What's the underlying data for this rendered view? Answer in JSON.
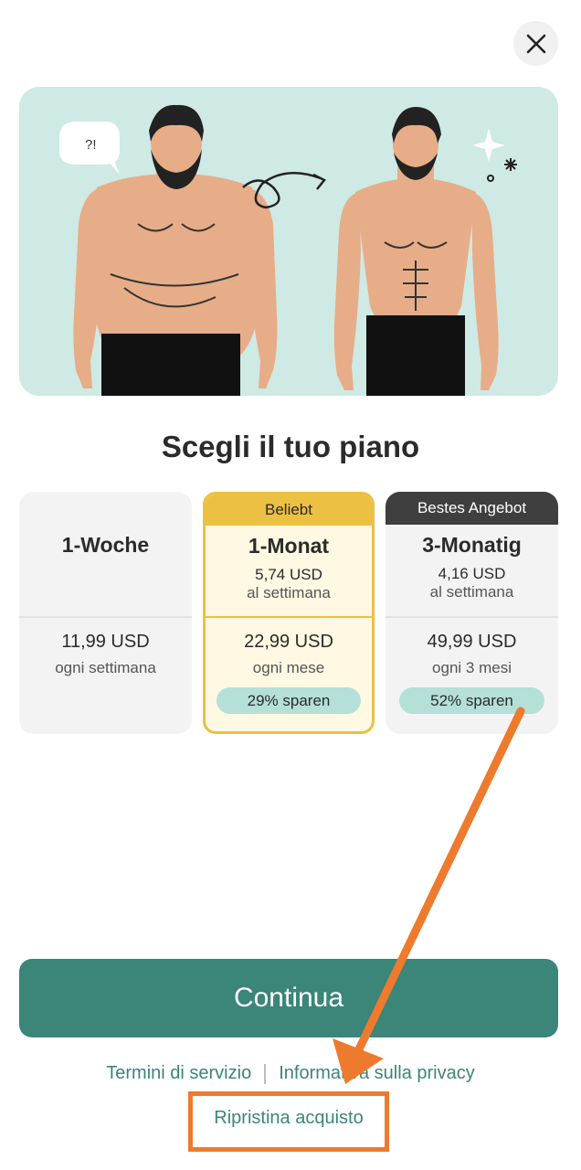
{
  "header": {
    "close_icon": "close-icon"
  },
  "hero": {
    "speech_bubble": "?!"
  },
  "title": "Scegli il tuo piano",
  "plans": [
    {
      "name": "1-Woche",
      "price": "11,99 USD",
      "period": "ogni settimana"
    },
    {
      "badge": "Beliebt",
      "name": "1-Monat",
      "weekly_price": "5,74 USD",
      "weekly_label": "al settimana",
      "price": "22,99 USD",
      "period": "ogni mese",
      "savings": "29% sparen"
    },
    {
      "badge": "Bestes Angebot",
      "name": "3-Monatig",
      "weekly_price": "4,16 USD",
      "weekly_label": "al settimana",
      "price": "49,99 USD",
      "period": "ogni 3 mesi",
      "savings": "52% sparen"
    }
  ],
  "continue_label": "Continua",
  "footer": {
    "terms": "Termini di servizio",
    "privacy": "Informativa sulla privacy",
    "restore": "Ripristina acquisto"
  },
  "colors": {
    "accent": "#3b8579",
    "highlight": "#ecc043",
    "annotation": "#ee7a2e",
    "savings_bg": "#b4e0d8"
  }
}
